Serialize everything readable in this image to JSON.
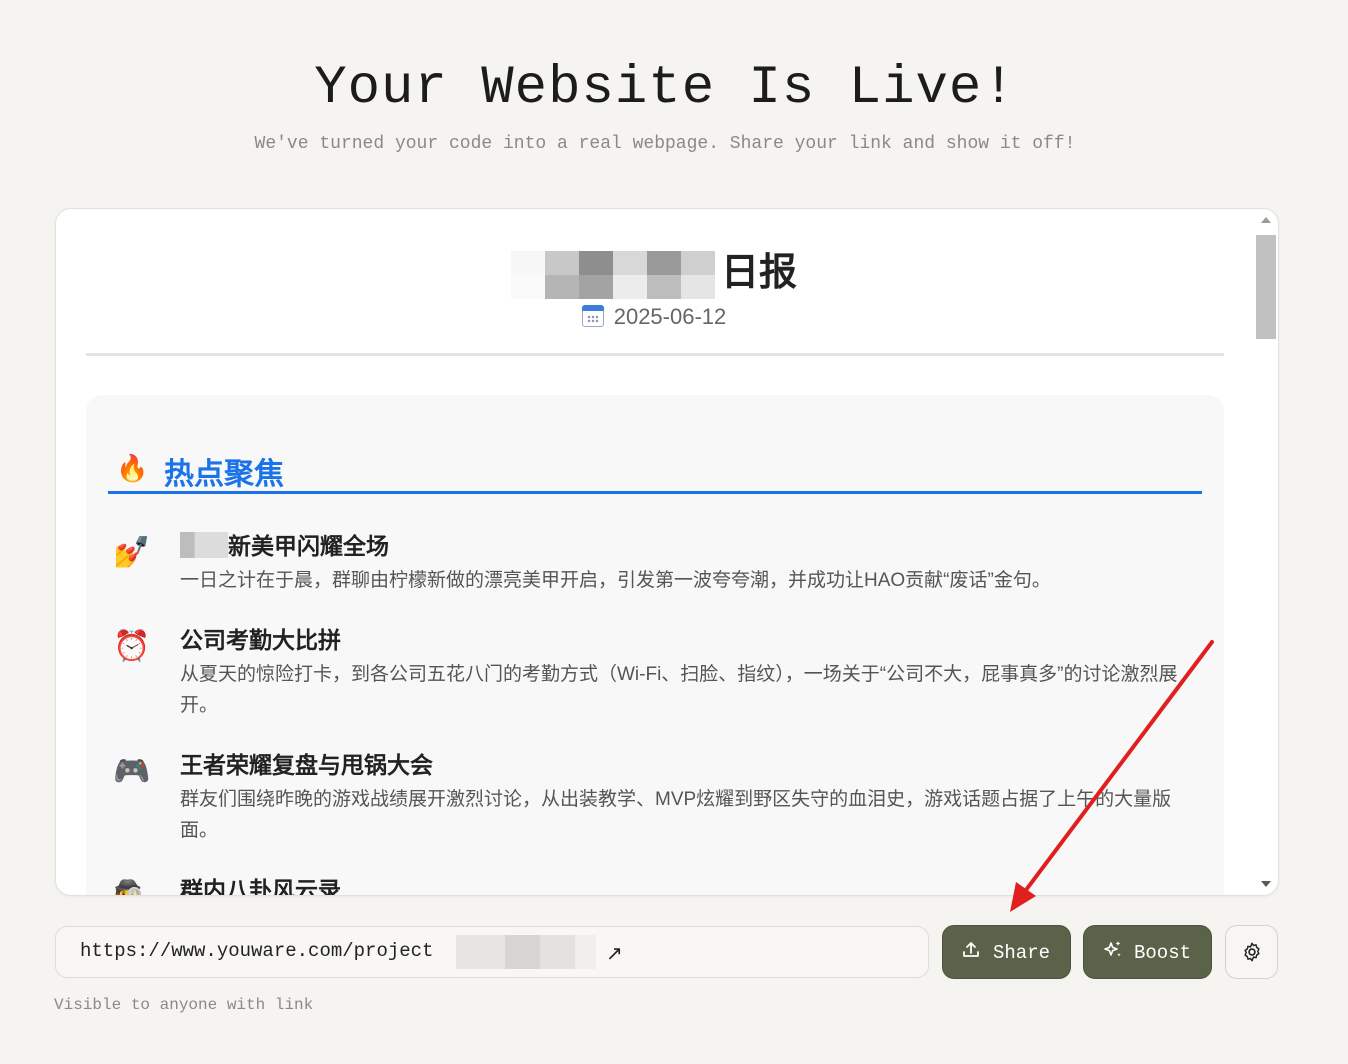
{
  "hero": {
    "title": "Your Website Is Live!",
    "subtitle": "We've turned your code into a real webpage. Share your link and show it off!"
  },
  "preview": {
    "title_suffix": "日报",
    "date_icon": "calendar-icon",
    "date": "2025-06-12",
    "section": {
      "icon": "fire-icon",
      "title": "热点聚焦",
      "accent": "#1a73e8",
      "items": [
        {
          "icon": "nail-polish-icon",
          "glyph": "💅",
          "title": "新美甲闪耀全场",
          "desc": "一日之计在于晨，群聊由柠檬新做的漂亮美甲开启，引发第一波夸夸潮，并成功让HAO贡献“废话”金句。"
        },
        {
          "icon": "alarm-clock-icon",
          "glyph": "⏰",
          "title": "公司考勤大比拼",
          "desc": "从夏天的惊险打卡，到各公司五花八门的考勤方式（Wi-Fi、扫脸、指纹），一场关于“公司不大，屁事真多”的讨论激烈展开。"
        },
        {
          "icon": "game-controller-icon",
          "glyph": "🎮",
          "title": "王者荣耀复盘与甩锅大会",
          "desc": "群友们围绕昨晚的游戏战绩展开激烈讨论，从出装教学、MVP炫耀到野区失守的血泪史，游戏话题占据了上午的大量版面。"
        },
        {
          "icon": "detective-hat-icon",
          "glyph": "🕵",
          "title": "群内八卦风云录",
          "desc": ""
        }
      ]
    }
  },
  "share_bar": {
    "url": "https://www.youware.com/project",
    "open_icon": "external-link-icon",
    "visibility_note": "Visible to anyone with link",
    "share_label": "Share",
    "boost_label": "Boost",
    "settings_icon": "gear-icon",
    "button_color": "#5a6249",
    "annotation_color": "#e02020"
  }
}
